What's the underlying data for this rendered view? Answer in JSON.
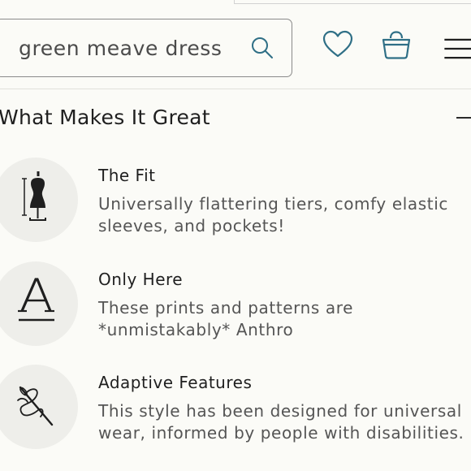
{
  "search": {
    "value": "green meave dress",
    "placeholder": "Search"
  },
  "header": {
    "icons": [
      "search-icon",
      "heart-icon",
      "shopping-bag-icon",
      "hamburger-menu-icon"
    ]
  },
  "section": {
    "title": "What Makes It Great",
    "expanded": true
  },
  "features": [
    {
      "icon": "dress-form-icon",
      "title": "The Fit",
      "description": "Universally flattering tiers, comfy elastic sleeves, and pockets!"
    },
    {
      "icon": "letter-a-icon",
      "title": "Only Here",
      "description": "These prints and patterns are *unmistakably* Anthro"
    },
    {
      "icon": "needle-thread-icon",
      "title": "Adaptive Features",
      "description": "This style has been designed for universal wear, informed by people with disabilities."
    }
  ],
  "colors": {
    "background": "#fbfbf7",
    "accent_teal": "#2f6f86",
    "text": "#1f1f1f",
    "muted_text": "#555555",
    "icon_circle": "#eeeeea"
  }
}
